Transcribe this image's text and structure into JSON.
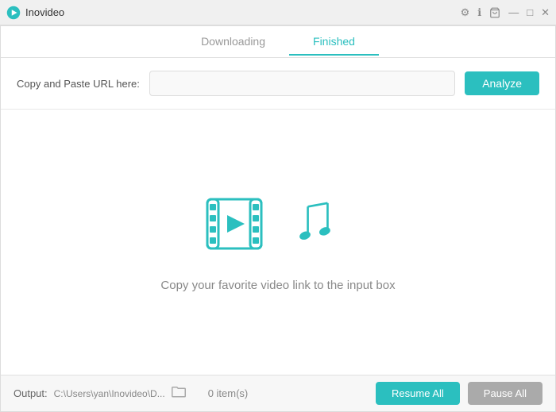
{
  "titlebar": {
    "icon_label": "inovideo-app-icon",
    "title": "Inovideo",
    "controls": {
      "settings": "⚙",
      "info": "ℹ",
      "cart": "🛒",
      "minimize": "—",
      "maximize": "□",
      "close": "✕"
    }
  },
  "tabs": [
    {
      "id": "downloading",
      "label": "Downloading",
      "active": false
    },
    {
      "id": "finished",
      "label": "Finished",
      "active": true
    }
  ],
  "url_section": {
    "label": "Copy and Paste URL here:",
    "input_placeholder": "",
    "analyze_button": "Analyze"
  },
  "empty_state": {
    "message": "Copy your favorite video link to the input box"
  },
  "bottom_bar": {
    "output_label": "Output:",
    "output_path": "C:\\Users\\yan\\Inovideo\\D...",
    "items_count": "0 item(s)",
    "resume_button": "Resume All",
    "pause_button": "Pause All"
  }
}
